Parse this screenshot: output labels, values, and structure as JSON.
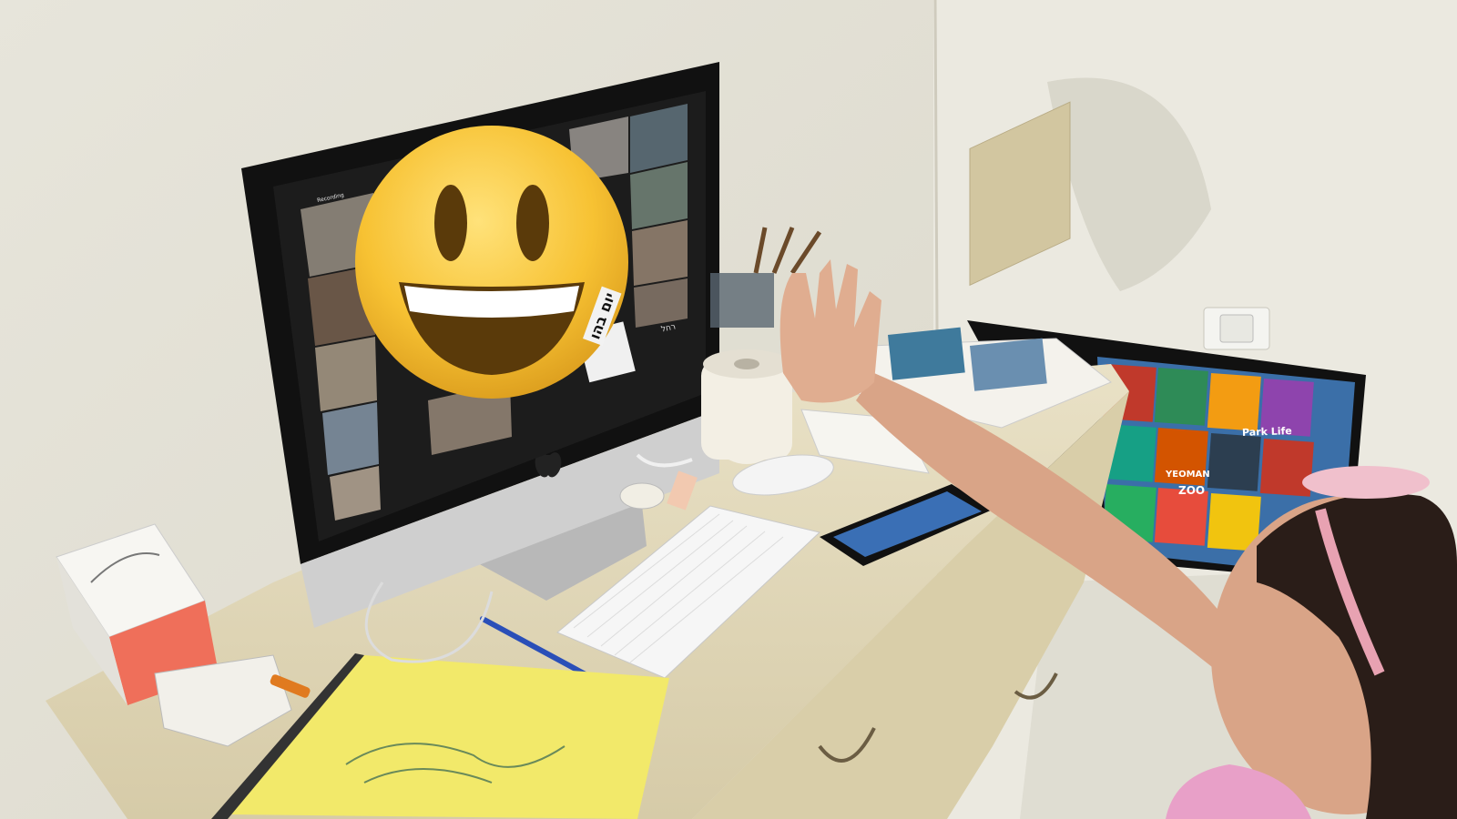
{
  "photo": {
    "subject": "child-waving-at-video-call",
    "colors": {
      "wall": "#e9e7dd",
      "wall_shadow": "#d6d3c6",
      "desk": "#e5dcbf",
      "monitor_frame": "#111111",
      "monitor_chin": "#c9c9c9",
      "emoji_face": "#f7c233",
      "paper_yellow": "#f2e96a",
      "hair": "#2a1d18",
      "skin": "#d9a487",
      "headband": "#e8a2b2"
    },
    "icons": [
      "smiley-emoji-icon",
      "apple-logo-icon"
    ]
  },
  "screen": {
    "recording_label": "Recording",
    "hebrew_banner": "יום בהו",
    "name_label": "רחל"
  },
  "poster": {
    "park_label": "Park Life",
    "yeoman_label": "YEOMAN",
    "zoo_label": "ZOO"
  }
}
